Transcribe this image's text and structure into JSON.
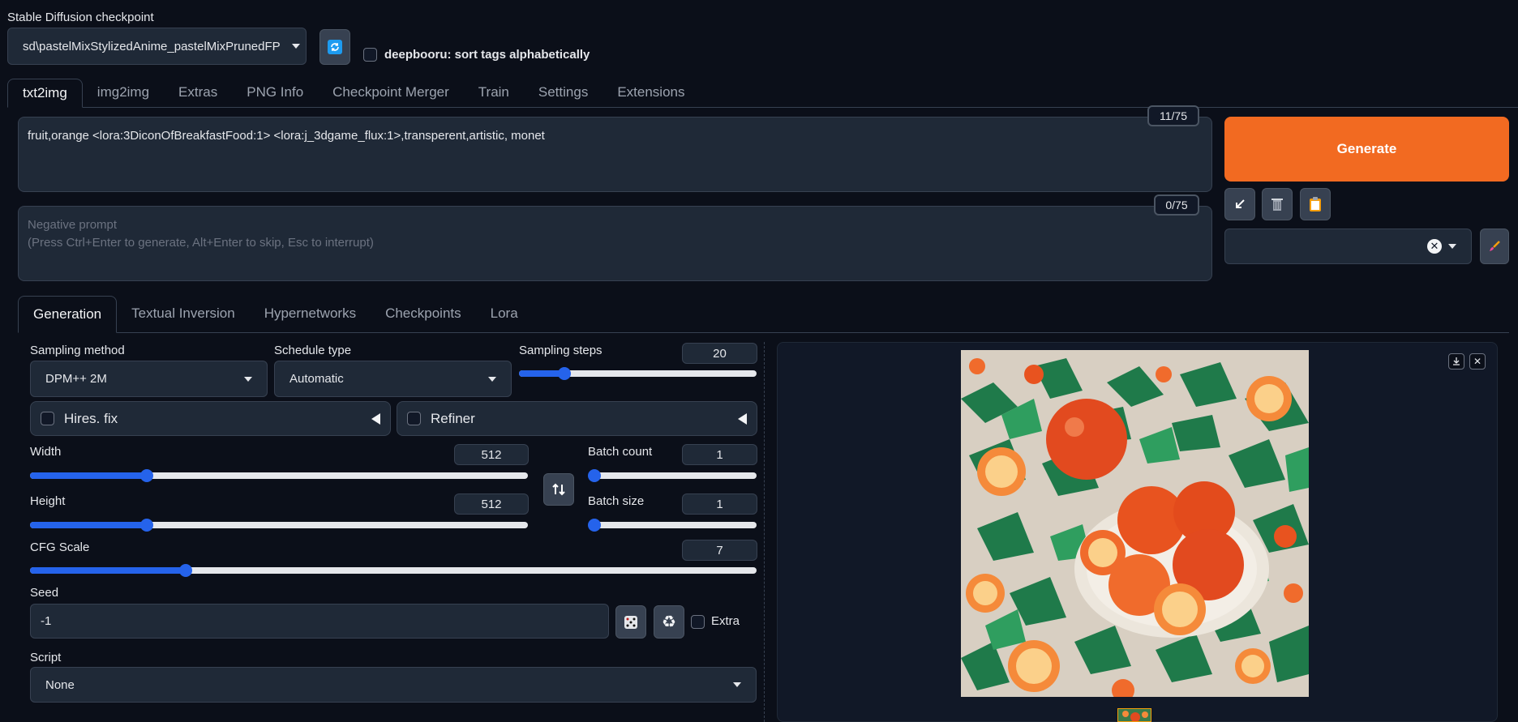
{
  "checkpoint": {
    "label": "Stable Diffusion checkpoint",
    "value": "sd\\pastelMixStylizedAnime_pastelMixPrunedFP",
    "refresh_icon": "refresh-icon"
  },
  "deepbooru": {
    "label": "deepbooru: sort tags alphabetically",
    "checked": false
  },
  "main_tabs": [
    "txt2img",
    "img2img",
    "Extras",
    "PNG Info",
    "Checkpoint Merger",
    "Train",
    "Settings",
    "Extensions"
  ],
  "prompt": {
    "value": "fruit,orange <lora:3DiconOfBreakfastFood:1>  <lora:j_3dgame_flux:1>,transperent,artistic, monet",
    "counter": "11/75"
  },
  "negative_prompt": {
    "placeholder_line1": "Negative prompt",
    "placeholder_line2": "(Press Ctrl+Enter to generate, Alt+Enter to skip, Esc to interrupt)",
    "counter": "0/75"
  },
  "generate_label": "Generate",
  "colors": {
    "accent": "#f26a21",
    "slider": "#2563eb",
    "bg": "#0b0f19",
    "panel": "#1f2937"
  },
  "sub_tabs": [
    "Generation",
    "Textual Inversion",
    "Hypernetworks",
    "Checkpoints",
    "Lora"
  ],
  "sampling_method": {
    "label": "Sampling method",
    "value": "DPM++ 2M"
  },
  "schedule_type": {
    "label": "Schedule type",
    "value": "Automatic"
  },
  "sampling_steps": {
    "label": "Sampling steps",
    "value": "20",
    "fraction": 0.19
  },
  "hires_fix": {
    "label": "Hires. fix"
  },
  "refiner": {
    "label": "Refiner"
  },
  "width": {
    "label": "Width",
    "value": "512",
    "fraction": 0.235
  },
  "height": {
    "label": "Height",
    "value": "512",
    "fraction": 0.235
  },
  "batch_count": {
    "label": "Batch count",
    "value": "1",
    "fraction": 0
  },
  "batch_size": {
    "label": "Batch size",
    "value": "1",
    "fraction": 0
  },
  "cfg_scale": {
    "label": "CFG Scale",
    "value": "7",
    "fraction": 0.214
  },
  "seed": {
    "label": "Seed",
    "value": "-1"
  },
  "extra": {
    "label": "Extra"
  },
  "script": {
    "label": "Script",
    "value": "None"
  }
}
